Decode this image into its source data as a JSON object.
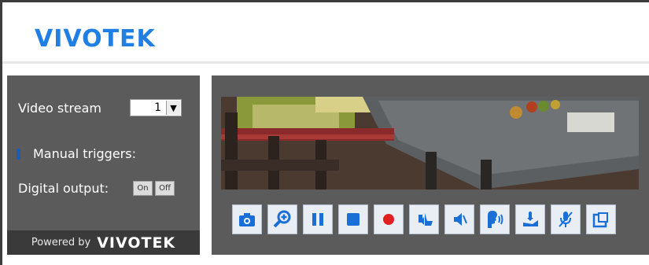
{
  "header": {
    "logo_text": "VIVOTEK",
    "logo_color": "#1f7fe5"
  },
  "sidebar": {
    "video_stream_label": "Video stream",
    "video_stream_value": "1",
    "manual_triggers_label": "Manual triggers:",
    "digital_output_label": "Digital output:",
    "digital_output_on": "On",
    "digital_output_off": "Off",
    "powered_by_text": "Powered by",
    "powered_by_logo": "VIVOTEK"
  },
  "toolbar": {
    "buttons": [
      "snapshot-icon",
      "digital-zoom-icon",
      "pause-icon",
      "stop-icon",
      "record-icon",
      "volume-icon",
      "mute-icon",
      "talk-icon",
      "microphone-volume-icon",
      "microphone-mute-icon",
      "fullscreen-icon"
    ],
    "accent_color": "#1a6fd6",
    "record_color": "#e02020"
  }
}
